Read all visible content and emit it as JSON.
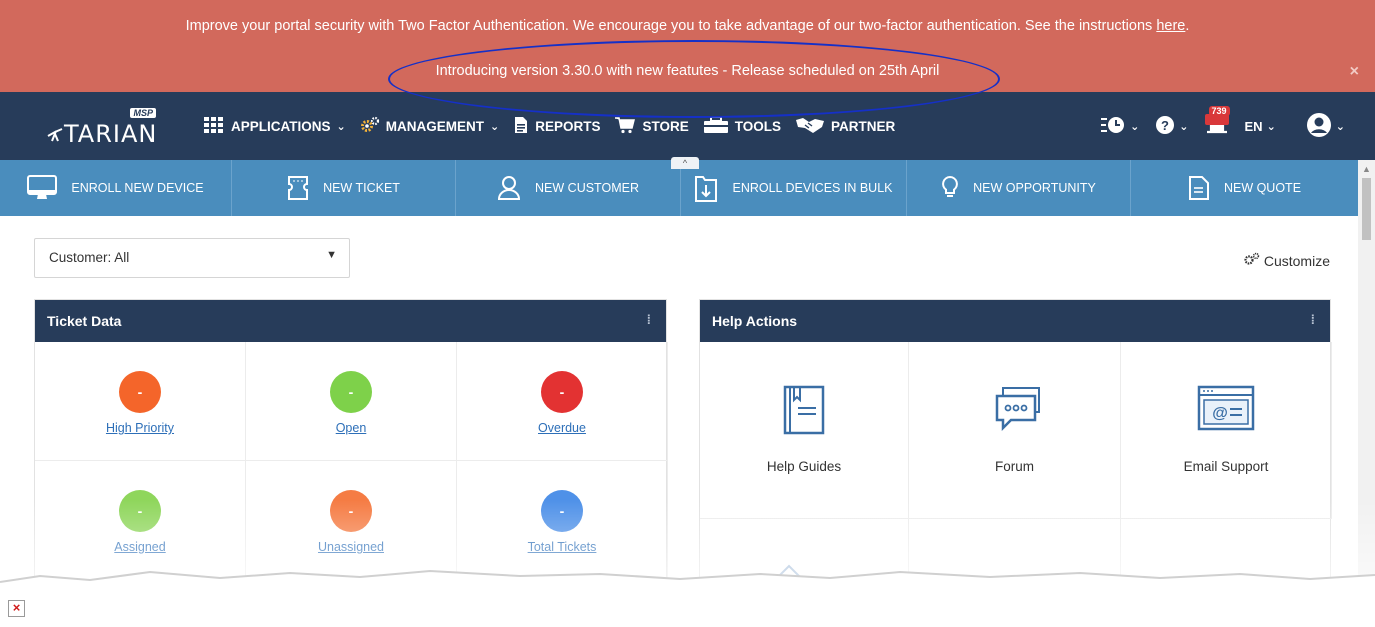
{
  "banner": {
    "line1_text": "Improve your portal security with Two Factor Authentication. We encourage you to take advantage of our two-factor authentication. See the instructions ",
    "line1_link": "here",
    "line1_end": ".",
    "line2_text": "Introducing version 3.30.0 with new featutes - Release scheduled on 25th April",
    "close": "×",
    "color": "#d2695c"
  },
  "navbar": {
    "logo_text": "TARIAN",
    "logo_badge": "MSP",
    "items": [
      {
        "label": "APPLICATIONS",
        "icon": "grid-icon",
        "dropdown": "⌄"
      },
      {
        "label": "MANAGEMENT",
        "icon": "gears-icon",
        "dropdown": "⌄"
      },
      {
        "label": "REPORTS",
        "icon": "report-icon"
      },
      {
        "label": "STORE",
        "icon": "cart-icon"
      },
      {
        "label": "TOOLS",
        "icon": "toolbox-icon"
      },
      {
        "label": "PARTNER",
        "icon": "handshake-icon"
      }
    ],
    "right": {
      "history_caret": "⌄",
      "help_caret": "⌄",
      "notification_count": "739",
      "language": "EN",
      "language_caret": "⌄",
      "user_caret": "⌄"
    },
    "color": "#273c5a"
  },
  "quick_actions": [
    {
      "label": "ENROLL NEW DEVICE",
      "icon": "monitor-icon"
    },
    {
      "label": "NEW TICKET",
      "icon": "ticket-icon"
    },
    {
      "label": "NEW CUSTOMER",
      "icon": "user-icon"
    },
    {
      "label": "ENROLL DEVICES IN BULK",
      "icon": "bulk-enroll-icon"
    },
    {
      "label": "NEW OPPORTUNITY",
      "icon": "lightbulb-icon"
    },
    {
      "label": "NEW QUOTE",
      "icon": "document-icon"
    }
  ],
  "quickbar_color": "#4a8dbd",
  "collapse_glyph": "^",
  "filter": {
    "label": "Customer: All",
    "caret": "▼"
  },
  "customize_label": "Customize",
  "ticket_panel": {
    "title": "Ticket Data",
    "grip": "⁞",
    "cells": [
      {
        "label": "High Priority",
        "value": "-",
        "color": "#f4652a"
      },
      {
        "label": "Open",
        "value": "-",
        "color": "#7ed14a"
      },
      {
        "label": "Overdue",
        "value": "-",
        "color": "#e33232"
      },
      {
        "label": "Assigned",
        "value": "-",
        "color": "#8fd65c"
      },
      {
        "label": "Unassigned",
        "value": "-",
        "color": "#f57c44"
      },
      {
        "label": "Total Tickets",
        "value": "-",
        "color": "#4f91e8"
      }
    ]
  },
  "help_panel": {
    "title": "Help Actions",
    "grip": "⁞",
    "cells": [
      {
        "label": "Help Guides",
        "icon": "book-icon"
      },
      {
        "label": "Forum",
        "icon": "chat-icon"
      },
      {
        "label": "Email Support",
        "icon": "email-icon"
      }
    ]
  },
  "broken_image_glyph": "×"
}
